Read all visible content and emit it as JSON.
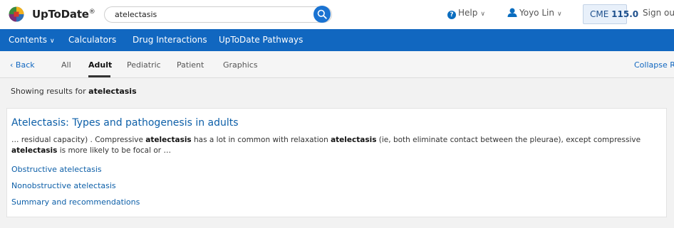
{
  "header": {
    "brand": "UpToDate",
    "brand_mark": "®",
    "search_value": "atelectasis",
    "search_clear": "×",
    "help_label": "Help",
    "user_name": "Yoyo Lin",
    "cme_label": "CME",
    "cme_value": "115.0",
    "signin_label": "Sign out"
  },
  "nav": {
    "items": [
      {
        "label": "Contents"
      },
      {
        "label": "Calculators"
      },
      {
        "label": "Drug Interactions"
      },
      {
        "label": "UpToDate Pathways"
      }
    ]
  },
  "subnav": {
    "back": "Back",
    "tabs": [
      "All",
      "Adult",
      "Pediatric",
      "Patient",
      "Graphics"
    ],
    "active_tab": "Adult",
    "collapse_label": "Collapse Results"
  },
  "results": {
    "showing_prefix": "Showing results for",
    "query": "atelectasis",
    "card": {
      "title": "Atelectasis: Types and pathogenesis in adults",
      "snippet_parts": [
        {
          "text": "… residual capacity) . Compressive ",
          "bold": false
        },
        {
          "text": "atelectasis",
          "bold": true
        },
        {
          "text": " has a lot in common with relaxation ",
          "bold": false
        },
        {
          "text": "atelectasis",
          "bold": true
        },
        {
          "text": " (ie, both eliminate contact between the pleurae), except compressive ",
          "bold": false
        },
        {
          "text": "atelectasis",
          "bold": true
        },
        {
          "text": " is more likely to be focal or …",
          "bold": false
        }
      ],
      "sections": [
        "Obstructive atelectasis",
        "Nonobstructive atelectasis",
        "Summary and recommendations"
      ]
    }
  },
  "icons": {
    "logo": "uptodate-logo-icon",
    "search": "search-icon",
    "help": "help-icon",
    "user": "user-icon",
    "chevron": "chevron-down-icon",
    "back": "chevron-left-icon"
  },
  "colors": {
    "nav_blue": "#1167c0",
    "link_blue": "#0d5fa8",
    "cme_bg": "#e8f0fa"
  }
}
